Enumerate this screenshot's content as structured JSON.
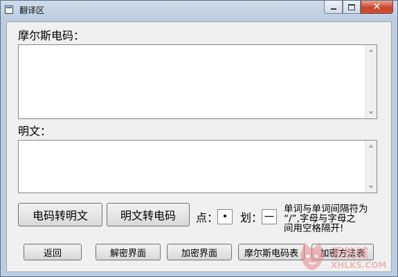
{
  "window": {
    "title": "翻译区"
  },
  "labels": {
    "morse": "摩尔斯电码：",
    "plain": "明文："
  },
  "inputs": {
    "morse_value": "",
    "plain_value": ""
  },
  "convert": {
    "to_plain": "电码转明文",
    "to_morse": "明文转电码"
  },
  "symbols": {
    "dot_label": "点：",
    "dot_value": "•",
    "dash_label": "划：",
    "dash_value": "一"
  },
  "note": [
    "单词与单词间隔符为",
    "“/”,字母与字母之",
    "间用空格隔开!"
  ],
  "nav": {
    "back": "返回",
    "decrypt": "解密界面",
    "encrypt": "加密界面",
    "morse_table": "摩尔斯电码表",
    "method_table": "加密方法表"
  },
  "watermark": {
    "cn": "系统城",
    "url": "XHLKS.COM"
  },
  "colors": {
    "close_button": "#c8452c",
    "title_bg": "#bccde0",
    "client_bg": "#f0f0f0"
  }
}
